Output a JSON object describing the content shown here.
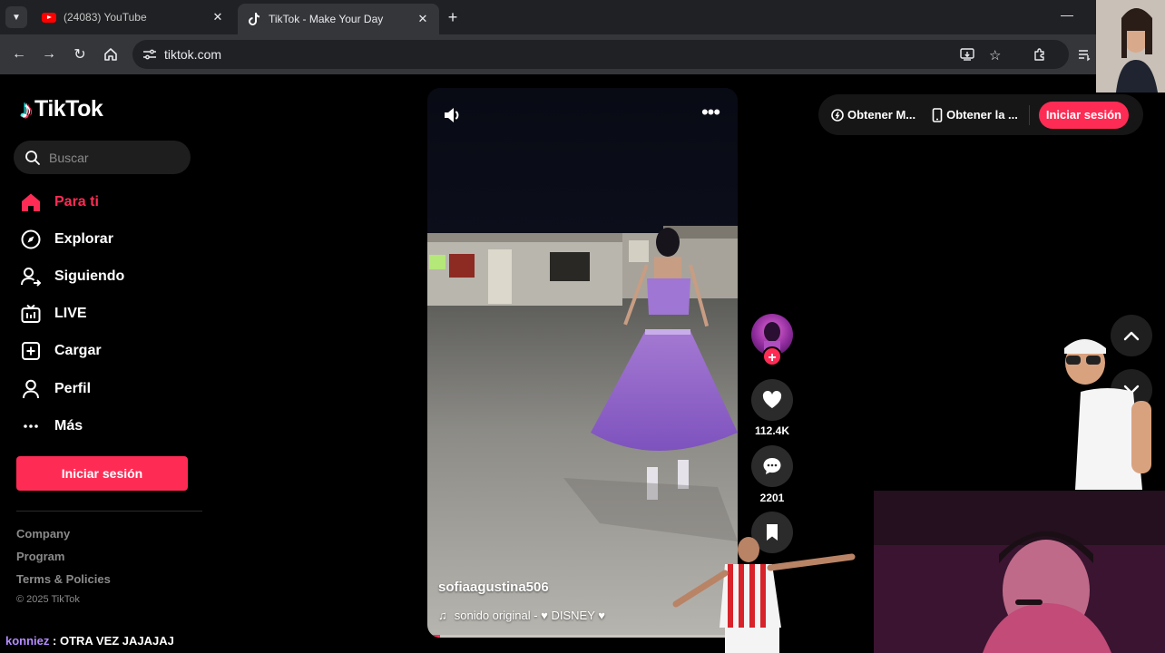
{
  "browser": {
    "tabs": [
      {
        "title": "(24083) YouTube",
        "icon": "youtube-icon",
        "active": false
      },
      {
        "title": "TikTok - Make Your Day",
        "icon": "tiktok-icon",
        "active": true
      }
    ],
    "url": "tiktok.com"
  },
  "sidebar": {
    "logo_text": "TikTok",
    "search_placeholder": "Buscar",
    "nav": [
      {
        "label": "Para ti",
        "icon": "home-icon",
        "active": true
      },
      {
        "label": "Explorar",
        "icon": "compass-icon",
        "active": false
      },
      {
        "label": "Siguiendo",
        "icon": "following-icon",
        "active": false
      },
      {
        "label": "LIVE",
        "icon": "live-icon",
        "active": false
      },
      {
        "label": "Cargar",
        "icon": "upload-icon",
        "active": false
      },
      {
        "label": "Perfil",
        "icon": "profile-icon",
        "active": false
      },
      {
        "label": "Más",
        "icon": "more-icon",
        "active": false
      }
    ],
    "login_label": "Iniciar sesión",
    "footer": {
      "company": "Company",
      "program": "Program",
      "terms": "Terms & Policies",
      "copyright": "© 2025 TikTok"
    }
  },
  "video": {
    "author": "sofiaagustina506",
    "sound": "sonido original - ♥ DISNEY ♥",
    "likes": "112.4K",
    "comments": "2201",
    "progress": 0.04
  },
  "topbar": {
    "item1": "Obtener M...",
    "item2": "Obtener la ...",
    "login_label": "Iniciar sesión"
  },
  "chat": {
    "user": "konniez",
    "message": " : OTRA VEZ JAJAJAJ"
  },
  "colors": {
    "brand": "#fe2c55",
    "chrome_dark": "#202124",
    "chrome_toolbar": "#35363a",
    "sidebar_bg": "#000000"
  }
}
